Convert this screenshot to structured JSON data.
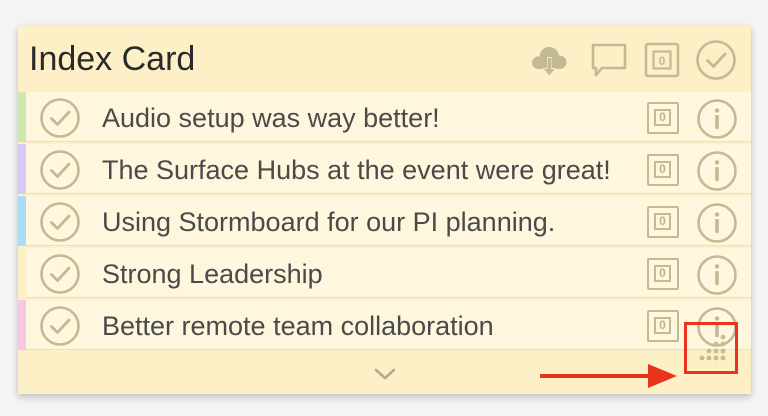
{
  "card": {
    "title": "Index Card",
    "header_vote_count": "0",
    "icons": {
      "download": "cloud-download-icon",
      "comment": "comment-icon",
      "vote": "vote-counter-icon",
      "complete": "check-circle-icon"
    },
    "colors": {
      "card_background": "#fdf0c6",
      "row_background": "#fef7dd",
      "icon_color": "#c4b995",
      "annotation_red": "#e8341c"
    }
  },
  "ideas": [
    {
      "text": "Audio setup was way better!",
      "votes": "0",
      "stripe_color": "#cfe8b0"
    },
    {
      "text": "The Surface Hubs at the event were great!",
      "votes": "0",
      "stripe_color": "#d8c9f4"
    },
    {
      "text": "Using Stormboard for our PI planning.",
      "votes": "0",
      "stripe_color": "#a9dcf5"
    },
    {
      "text": "Strong Leadership",
      "votes": "0",
      "stripe_color": "#fdf0c6"
    },
    {
      "text": "Better remote team collaboration",
      "votes": "0",
      "stripe_color": "#f4c8e3"
    }
  ],
  "footer": {
    "expand_icon": "chevron-down-icon",
    "resize_icon": "resize-handle-icon"
  }
}
